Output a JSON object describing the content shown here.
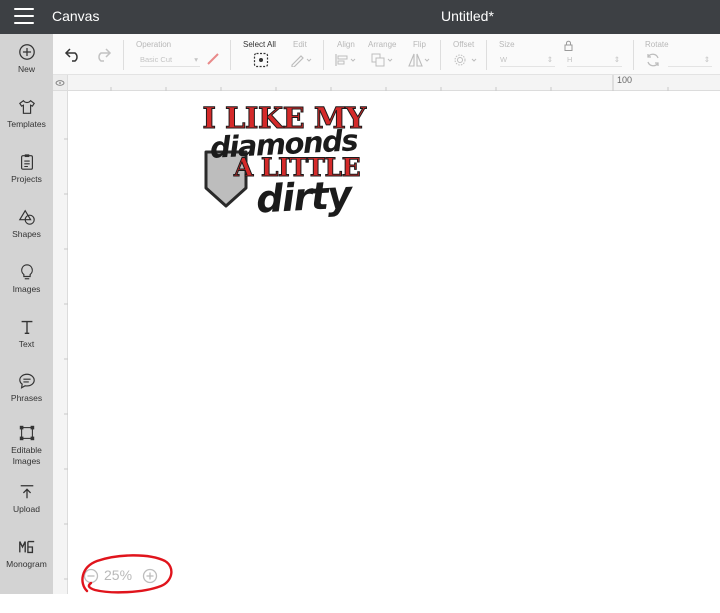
{
  "app": {
    "title": "Canvas",
    "document_title": "Untitled*"
  },
  "sidebar": {
    "items": [
      {
        "label": "New",
        "icon": "plus-circle-icon"
      },
      {
        "label": "Templates",
        "icon": "shirt-icon"
      },
      {
        "label": "Projects",
        "icon": "clipboard-icon"
      },
      {
        "label": "Shapes",
        "icon": "shapes-icon"
      },
      {
        "label": "Images",
        "icon": "lightbulb-icon"
      },
      {
        "label": "Text",
        "icon": "text-icon"
      },
      {
        "label": "Phrases",
        "icon": "speech-bubble-icon"
      },
      {
        "label": "Editable",
        "label2": "Images",
        "icon": "editable-images-icon"
      },
      {
        "label": "Upload",
        "icon": "upload-icon"
      },
      {
        "label": "Monogram",
        "icon": "monogram-icon"
      }
    ]
  },
  "toolbar": {
    "operation_label": "Operation",
    "operation_value": "Basic Cut",
    "select_all_label": "Select All",
    "edit_label": "Edit",
    "align_label": "Align",
    "arrange_label": "Arrange",
    "flip_label": "Flip",
    "offset_label": "Offset",
    "size_label": "Size",
    "size_w": "W",
    "size_h": "H",
    "rotate_label": "Rotate"
  },
  "ruler": {
    "top_marker": "100"
  },
  "design": {
    "line1": "I LIKE MY",
    "line2": "diamonds",
    "line3": "A LITTLE",
    "line4": "dirty",
    "colors": {
      "red": "#d42a2a",
      "black": "#1b1b1b",
      "plate": "#bdbdbd"
    }
  },
  "zoom": {
    "value": "25%"
  },
  "annotation": {
    "color": "#e0141c"
  },
  "colors": {
    "topbar": "#3d4044",
    "sidebar": "#d3d3d3"
  }
}
